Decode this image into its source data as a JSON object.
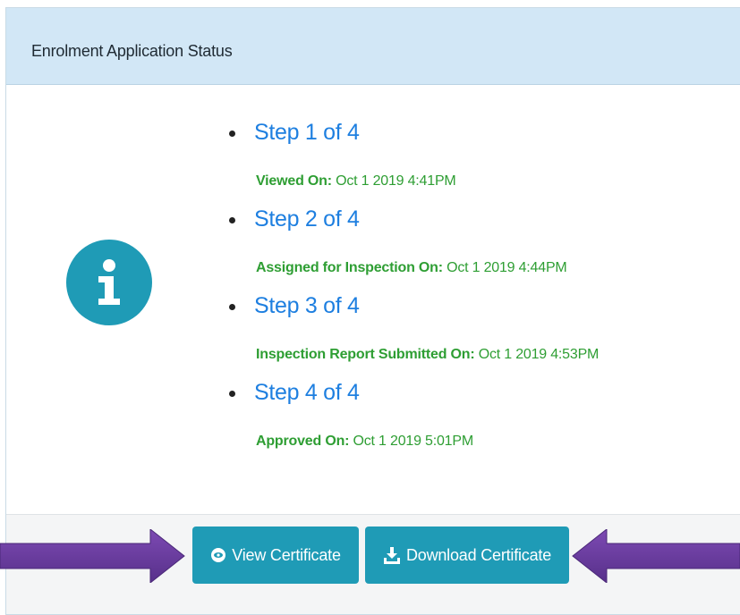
{
  "panel": {
    "title": "Enrolment Application Status"
  },
  "steps": [
    {
      "title": "Step 1 of 4",
      "label": "Viewed On:",
      "value": "Oct 1 2019 4:41PM"
    },
    {
      "title": "Step 2 of 4",
      "label": "Assigned for Inspection On:",
      "value": "Oct 1 2019 4:44PM"
    },
    {
      "title": "Step 3 of 4",
      "label": "Inspection Report Submitted On:",
      "value": "Oct 1 2019 4:53PM"
    },
    {
      "title": "Step 4 of 4",
      "label": "Approved On:",
      "value": "Oct 1 2019 5:01PM"
    }
  ],
  "footer": {
    "view_label": "View Certificate",
    "download_label": "Download Certificate"
  },
  "icons": {
    "status": "info-icon",
    "view": "eye-icon",
    "download": "download-icon",
    "annotation_left": "arrow-right-icon",
    "annotation_right": "arrow-left-icon"
  },
  "colors": {
    "header_bg": "#d2e7f6",
    "step_title": "#1e7fe0",
    "step_detail": "#2e9e33",
    "button_bg": "#1f9bb6",
    "arrow": "#6b3fa0"
  }
}
